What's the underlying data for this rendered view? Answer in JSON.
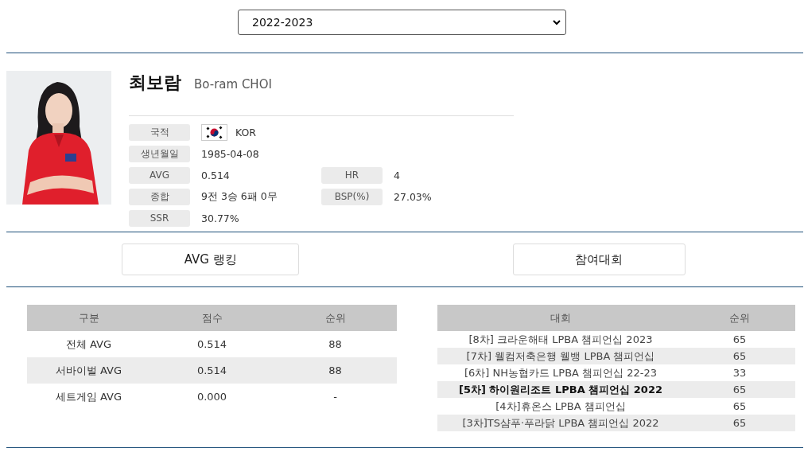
{
  "season_select": {
    "value": "2022-2023"
  },
  "player": {
    "name_ko": "최보람",
    "name_en": "Bo-ram CHOI",
    "fields": [
      {
        "label": "국적",
        "value": "KOR",
        "flag": true
      },
      {
        "label": "생년월일",
        "value": "1985-04-08"
      },
      {
        "label": "AVG",
        "value": "0.514",
        "label2": "HR",
        "value2": "4"
      },
      {
        "label": "종합",
        "value": "9전 3승 6패 0무",
        "label2": "BSP(%)",
        "value2": "27.03%"
      },
      {
        "label": "SSR",
        "value": "30.77%"
      }
    ]
  },
  "sections": [
    {
      "label": "AVG 랭킹"
    },
    {
      "label": "참여대회"
    }
  ],
  "avg_table": {
    "columns": [
      "구분",
      "점수",
      "순위"
    ],
    "rows": [
      [
        "전체 AVG",
        "0.514",
        "88"
      ],
      [
        "서바이벌 AVG",
        "0.514",
        "88"
      ],
      [
        "세트게임 AVG",
        "0.000",
        "-"
      ]
    ]
  },
  "event_table": {
    "columns": [
      "대회",
      "순위"
    ],
    "rows": [
      {
        "event": "[8차] 크라운해태 LPBA 챔피언십 2023",
        "rank": "65",
        "bold": false
      },
      {
        "event": "[7차] 웰컴저축은행 웰뱅 LPBA 챔피언십",
        "rank": "65",
        "bold": false
      },
      {
        "event": "[6차] NH농협카드 LPBA 챔피언십 22-23",
        "rank": "33",
        "bold": false
      },
      {
        "event": "[5차] 하이원리조트 LPBA 챔피언십 2022",
        "rank": "65",
        "bold": true
      },
      {
        "event": "[4차]휴온스 LPBA 챔피언십",
        "rank": "65",
        "bold": false
      },
      {
        "event": "[3차]TS샴푸·푸라닭 LPBA 챔피언십 2022",
        "rank": "65",
        "bold": false
      }
    ]
  }
}
